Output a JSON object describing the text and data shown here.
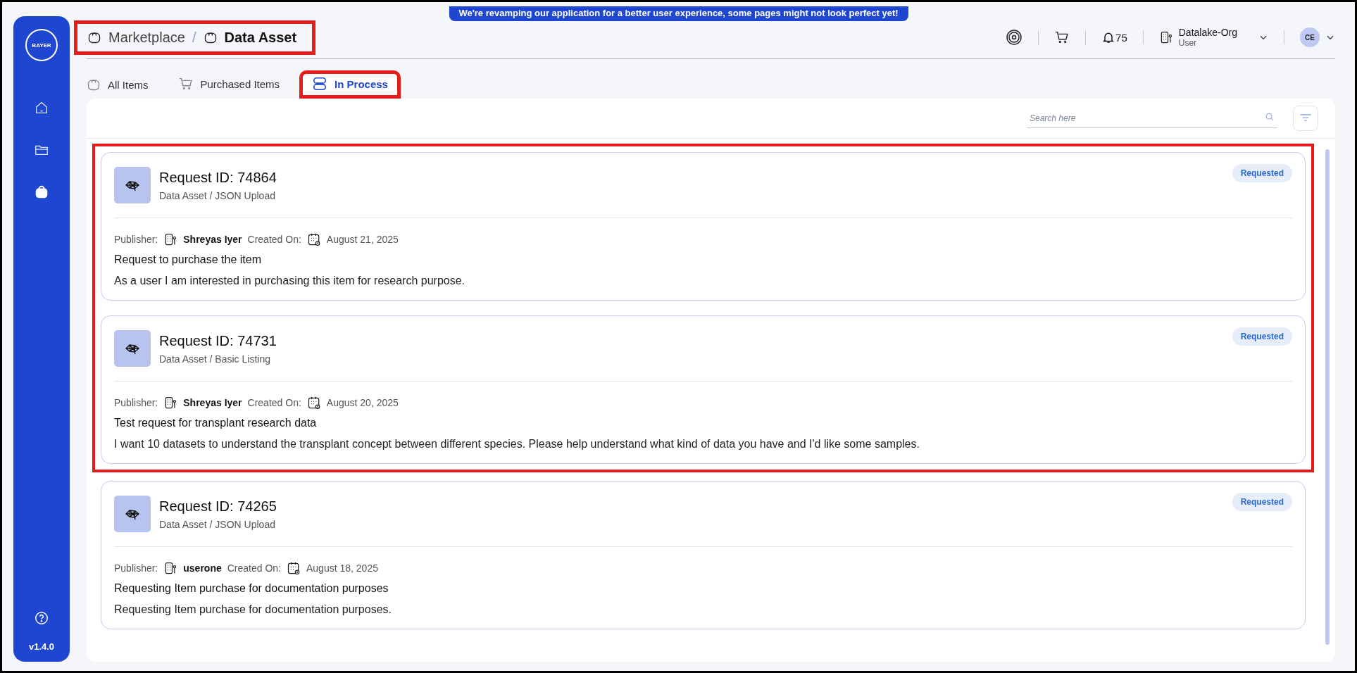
{
  "banner": "We're revamping our application for a better user experience, some pages might not look perfect yet!",
  "sidebar": {
    "version": "v1.4.0",
    "logo_text": "BAYER",
    "items": [
      {
        "kind": "home",
        "selected": false
      },
      {
        "kind": "folder",
        "selected": false
      },
      {
        "kind": "bag",
        "selected": true
      }
    ]
  },
  "breadcrumb": {
    "highlighted": true,
    "separator": "/",
    "items": [
      "Marketplace",
      "Data Asset"
    ]
  },
  "header": {
    "notifications": "75",
    "org": "Datalake-Org",
    "role": "User",
    "avatar": "CE"
  },
  "tabs": [
    {
      "label": "All Items",
      "kind": "bag",
      "selected": false,
      "highlighted": false
    },
    {
      "label": "Purchased Items",
      "kind": "cart",
      "selected": false,
      "highlighted": false
    },
    {
      "label": "In Process",
      "kind": "pills",
      "selected": true,
      "highlighted": true
    }
  ],
  "search": {
    "placeholder": "Search here"
  },
  "requests": [
    {
      "title": "Request ID: 74864",
      "subtitle": "Data Asset / JSON Upload",
      "status": "Requested",
      "publisher_label": "Publisher:",
      "publisher": "Shreyas Iyer",
      "created_label": "Created On:",
      "date": "August 21, 2025",
      "heading": "Request to purchase the item",
      "description": "As a user I am interested in purchasing this item for research purpose.",
      "highlighted": true
    },
    {
      "title": "Request ID: 74731",
      "subtitle": "Data Asset / Basic Listing",
      "status": "Requested",
      "publisher_label": "Publisher:",
      "publisher": "Shreyas Iyer",
      "created_label": "Created On:",
      "date": "August 20, 2025",
      "heading": "Test request for transplant research data",
      "description": "I want 10 datasets to understand the transplant concept between different species. Please help understand what kind of data you have and I'd like some samples.",
      "highlighted": true
    },
    {
      "title": "Request ID: 74265",
      "subtitle": "Data Asset / JSON Upload",
      "status": "Requested",
      "publisher_label": "Publisher:",
      "publisher": "userone",
      "created_label": "Created On:",
      "date": "August 18, 2025",
      "heading": "Requesting Item purchase for documentation purposes",
      "description": "Requesting Item purchase for documentation purposes.",
      "highlighted": false
    }
  ]
}
